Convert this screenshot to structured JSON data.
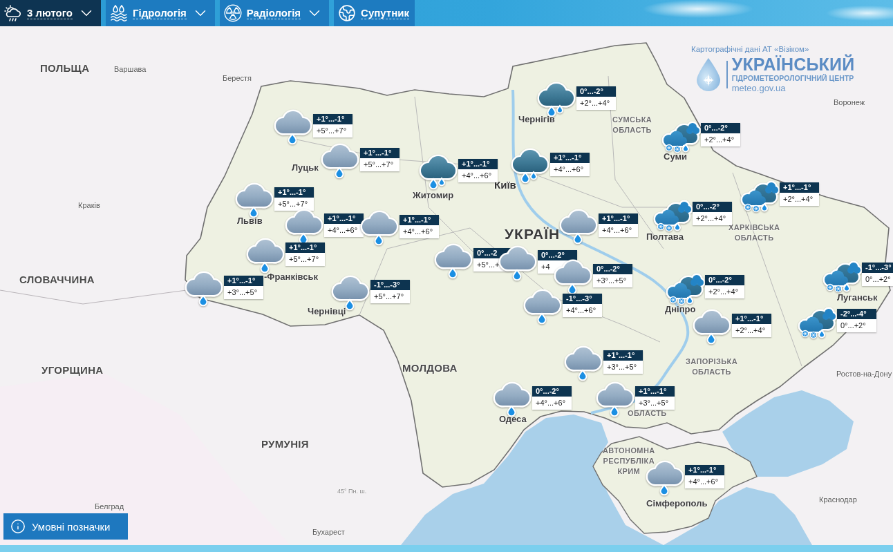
{
  "nav": {
    "items": [
      {
        "kind": "weather",
        "label": "3 лютого",
        "dropdown": true,
        "selected": true
      },
      {
        "kind": "hydrology",
        "label": "Гідрологія",
        "dropdown": true,
        "selected": false
      },
      {
        "kind": "radiology",
        "label": "Радіологія",
        "dropdown": true,
        "selected": false
      },
      {
        "kind": "satellite",
        "label": "Супутник",
        "dropdown": false,
        "selected": false
      }
    ]
  },
  "map": {
    "labels": [
      {
        "kind": "country",
        "text": "ПОЛЬЩА"
      },
      {
        "kind": "town",
        "text": "Варшава"
      },
      {
        "kind": "town",
        "text": "Берестя"
      },
      {
        "kind": "town",
        "text": "Воронеж"
      },
      {
        "kind": "city",
        "text": "Чернігів"
      },
      {
        "kind": "region",
        "text": "СУМСЬКА ОБЛАСТЬ"
      },
      {
        "kind": "city",
        "text": "Суми"
      },
      {
        "kind": "city",
        "text": "Луцьк"
      },
      {
        "kind": "capital",
        "text": "Київ"
      },
      {
        "kind": "city",
        "text": "Житомир"
      },
      {
        "kind": "town",
        "text": "Краків"
      },
      {
        "kind": "city",
        "text": "Львів"
      },
      {
        "kind": "country_main",
        "text": "УКРАЇН"
      },
      {
        "kind": "city",
        "text": "Полтава"
      },
      {
        "kind": "region",
        "text": "ХАРКІВСЬКА ОБЛАСТЬ"
      },
      {
        "kind": "country",
        "text": "СЛОВАЧЧИНА"
      },
      {
        "kind": "city",
        "text": "-Франківськ"
      },
      {
        "kind": "city",
        "text": "Луганськ"
      },
      {
        "kind": "city",
        "text": "Чернівці"
      },
      {
        "kind": "city",
        "text": "Дніпро"
      },
      {
        "kind": "country",
        "text": "УГОРЩИНА"
      },
      {
        "kind": "country",
        "text": "МОЛДОВА"
      },
      {
        "kind": "region",
        "text": "ЗАПОРІЗЬКА ОБЛАСТЬ"
      },
      {
        "kind": "town",
        "text": "Ростов-на-Дону"
      },
      {
        "kind": "city",
        "text": "Одеса"
      },
      {
        "kind": "region",
        "text": "ОБЛАСТЬ"
      },
      {
        "kind": "country",
        "text": "РУМУНІЯ"
      },
      {
        "kind": "region",
        "text": "АВТОНОМНА РЕСПУБЛІКА КРИМ"
      },
      {
        "kind": "grid",
        "text": "45° Пн. ш."
      },
      {
        "kind": "town",
        "text": "Белград"
      },
      {
        "kind": "city",
        "text": "Сімферополь"
      },
      {
        "kind": "town",
        "text": "Краснодар"
      },
      {
        "kind": "town",
        "text": "Бухарест"
      }
    ],
    "markers": [
      {
        "kind": "heavy_rain",
        "night": "0°...-2°",
        "day": "+2°...+4°"
      },
      {
        "kind": "rain",
        "night": "+1°...-1°",
        "day": "+5°...+7°"
      },
      {
        "kind": "sleet",
        "night": "0°...-2°",
        "day": "+2°...+4°"
      },
      {
        "kind": "rain",
        "night": "+1°...-1°",
        "day": "+5°...+7°"
      },
      {
        "kind": "heavy_rain",
        "night": "+1°...-1°",
        "day": "+4°...+6°"
      },
      {
        "kind": "heavy_rain",
        "night": "+1°...-1°",
        "day": "+4°...+6°"
      },
      {
        "kind": "sleet",
        "night": "+1°...-1°",
        "day": "+2°...+4°"
      },
      {
        "kind": "rain",
        "night": "+1°...-1°",
        "day": "+5°...+7°"
      },
      {
        "kind": "sleet",
        "night": "0°...-2°",
        "day": "+2°...+4°"
      },
      {
        "kind": "rain",
        "night": "+1°...-1°",
        "day": "+4°...+6°"
      },
      {
        "kind": "rain",
        "night": "+1°...-1°",
        "day": "+4°...+6°"
      },
      {
        "kind": "rain",
        "night": "+1°...-1°",
        "day": "+4°...+6°"
      },
      {
        "kind": "rain",
        "night": "+1°...-1°",
        "day": "+5°...+7°"
      },
      {
        "kind": "rain",
        "night": "0°...-2",
        "day": "+5°...+"
      },
      {
        "kind": "rain",
        "night": "0°...-2°",
        "day": "+4"
      },
      {
        "kind": "rain",
        "night": "0°...-2°",
        "day": "+3°...+5°"
      },
      {
        "kind": "rain",
        "night": "-1°...-3°",
        "day": "+4°...+6°"
      },
      {
        "kind": "rain",
        "night": "+1°...-1°",
        "day": "+3°...+5°"
      },
      {
        "kind": "rain",
        "night": "-1°...-3°",
        "day": "+5°...+7°"
      },
      {
        "kind": "sleet",
        "night": "0°...-2°",
        "day": "+2°...+4°"
      },
      {
        "kind": "sleet",
        "night": "-1°...-3°",
        "day": "0°...+2°"
      },
      {
        "kind": "rain",
        "night": "+1°...-1°",
        "day": "+2°...+4°"
      },
      {
        "kind": "sleet",
        "night": "-2°...-4°",
        "day": "0°...+2°"
      },
      {
        "kind": "rain",
        "night": "+1°...-1°",
        "day": "+3°...+5°"
      },
      {
        "kind": "rain",
        "night": "0°...-2°",
        "day": "+4°...+6°"
      },
      {
        "kind": "rain",
        "night": "+1°...-1°",
        "day": "+3°...+5°"
      },
      {
        "kind": "rain",
        "night": "+1°...-1°",
        "day": "+4°...+6°"
      }
    ]
  },
  "branding": {
    "attribution": "Картографічні дані АТ «Візіком»",
    "title": "УКРАЇНСЬКИЙ",
    "subtitle": "ГІДРОМЕТЕОРОЛОГІЧНИЙ ЦЕНТР",
    "website": "meteo.gov.ua"
  },
  "legend_button": {
    "label": "Умовні позначки"
  }
}
